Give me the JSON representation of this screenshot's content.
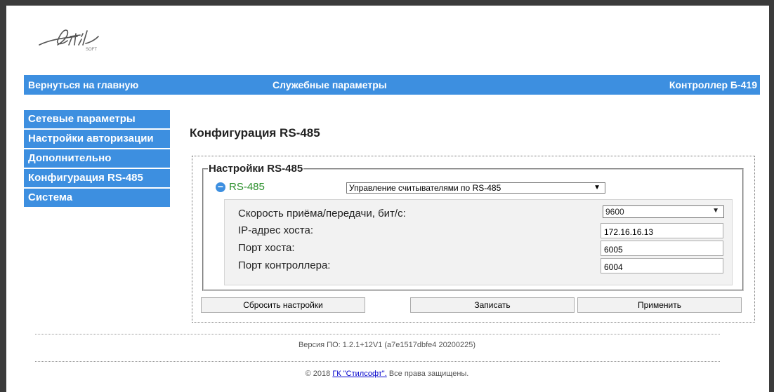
{
  "logo": {
    "brand_text": "Stil",
    "sub_text": "SOFT"
  },
  "header": {
    "back_link": "Вернуться на главную",
    "section": "Служебные параметры",
    "device": "Контроллер Б-419",
    "accent_color": "#3d8fe0"
  },
  "sidebar": {
    "items": [
      {
        "label": "Сетевые параметры"
      },
      {
        "label": "Настройки авторизации"
      },
      {
        "label": "Дополнительно"
      },
      {
        "label": "Конфигурация RS-485"
      },
      {
        "label": "Система"
      }
    ]
  },
  "main": {
    "title": "Конфигурация RS-485",
    "fieldset_legend": "Настройки RS-485",
    "rs_label": "RS-485",
    "rs_label_color": "#2a8f2a",
    "mode_select": "Управление считывателями по RS-485",
    "params": {
      "speed_label": "Скорость приёма/передачи, бит/с:",
      "speed_value": "9600",
      "ip_label": "IP-адрес хоста:",
      "ip_value": "172.16.16.13",
      "host_port_label": "Порт хоста:",
      "host_port_value": "6005",
      "ctrl_port_label": "Порт контроллера:",
      "ctrl_port_value": "6004"
    },
    "buttons": {
      "reset": "Сбросить настройки",
      "write": "Записать",
      "apply": "Применить"
    }
  },
  "footer": {
    "version": "Версия ПО: 1.2.1+12V1 (a7e1517dbfe4 20200225)",
    "copyright_prefix": "© 2018 ",
    "copyright_link": "ГК \"Стилсофт\".",
    "copyright_suffix": " Все права защищены."
  },
  "icons": {
    "collapse": "minus-circle-icon",
    "dropdown": "chevron-down-icon"
  }
}
